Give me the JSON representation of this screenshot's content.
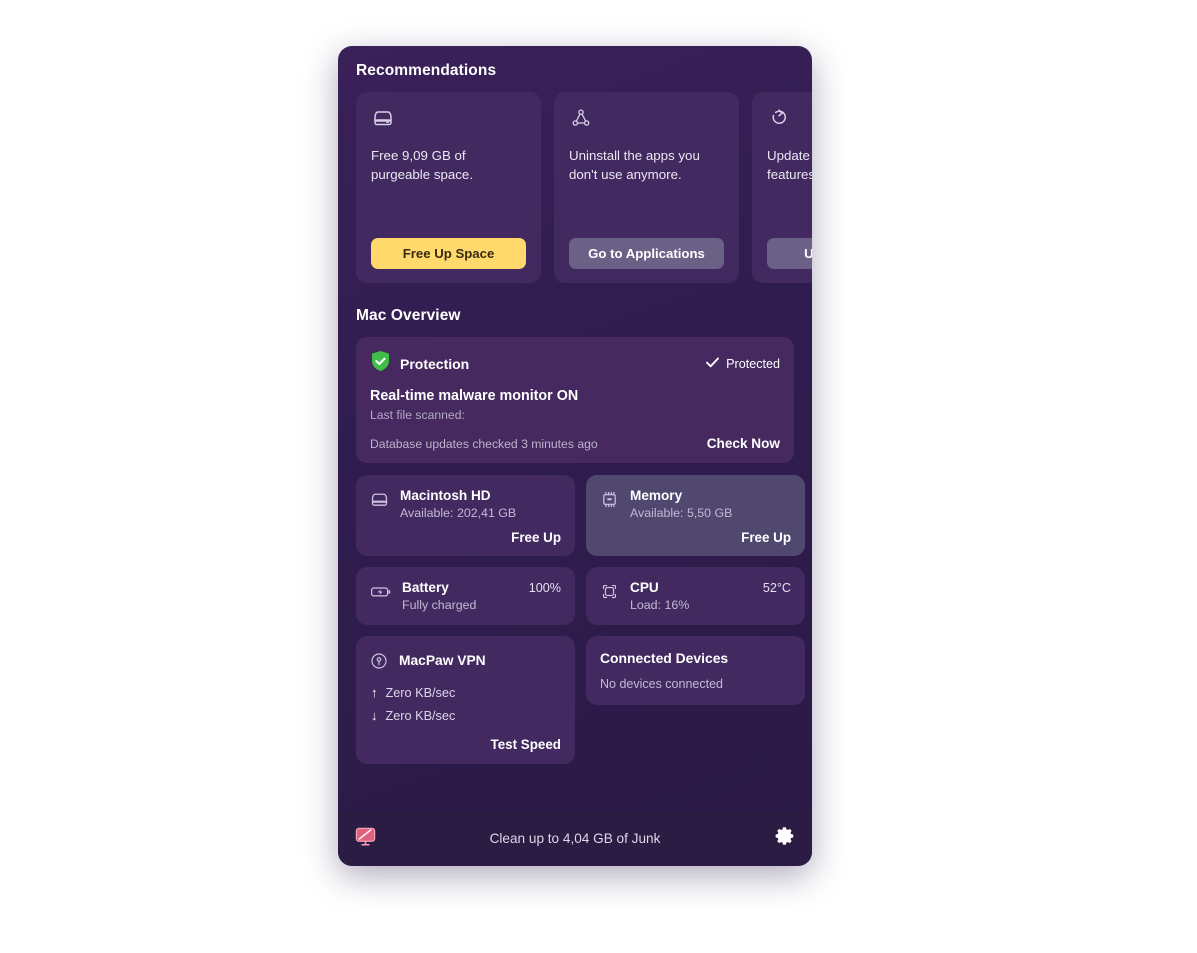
{
  "window": {
    "accent_yellow": "#ffd96b",
    "background": "#311d50",
    "card_background": "#422a60"
  },
  "recommendations": {
    "heading": "Recommendations",
    "cards": [
      {
        "icon": "hard-drive-icon",
        "text": "Free 9,09 GB of purgeable space.",
        "button": "Free Up Space",
        "button_style": "primary"
      },
      {
        "icon": "applications-icon",
        "text": "Uninstall the apps you don't use anymore.",
        "button": "Go to Applications",
        "button_style": "secondary"
      },
      {
        "icon": "updater-icon",
        "text": "Update apps to get new features and stay secure.",
        "button": "Update Apps",
        "button_style": "secondary"
      }
    ]
  },
  "overview": {
    "heading": "Mac Overview",
    "protection": {
      "title": "Protection",
      "status": "Protected",
      "status_icon": "checkmark-icon",
      "shield_icon": "green-shield-check-icon",
      "monitor_line": "Real-time malware monitor ON",
      "last_file_label": "Last file scanned:",
      "database_line": "Database updates checked 3 minutes ago",
      "check_action": "Check Now"
    },
    "stats": [
      {
        "icon": "hard-drive-icon",
        "name": "Macintosh HD",
        "sub": "Available: 202,41 GB",
        "value": "",
        "action": "Free Up",
        "highlight": false
      },
      {
        "icon": "memory-chip-icon",
        "name": "Memory",
        "sub": "Available: 5,50 GB",
        "value": "",
        "action": "Free Up",
        "highlight": true
      },
      {
        "icon": "battery-charging-icon",
        "name": "Battery",
        "sub": "Fully charged",
        "value": "100%",
        "action": "",
        "highlight": false
      },
      {
        "icon": "cpu-icon",
        "name": "CPU",
        "sub": "Load: 16%",
        "value": "52°C",
        "action": "",
        "highlight": false
      }
    ],
    "vpn": {
      "icon": "vpn-key-icon",
      "title": "MacPaw VPN",
      "upload_arrow": "↑",
      "upload": "Zero KB/sec",
      "download_arrow": "↓",
      "download": "Zero KB/sec",
      "action": "Test Speed"
    },
    "devices": {
      "title": "Connected Devices",
      "sub": "No devices connected"
    }
  },
  "status_bar": {
    "left_icon": "cleanmymac-monitor-icon",
    "text": "Clean up to 4,04 GB of Junk",
    "right_icon": "gear-icon"
  }
}
